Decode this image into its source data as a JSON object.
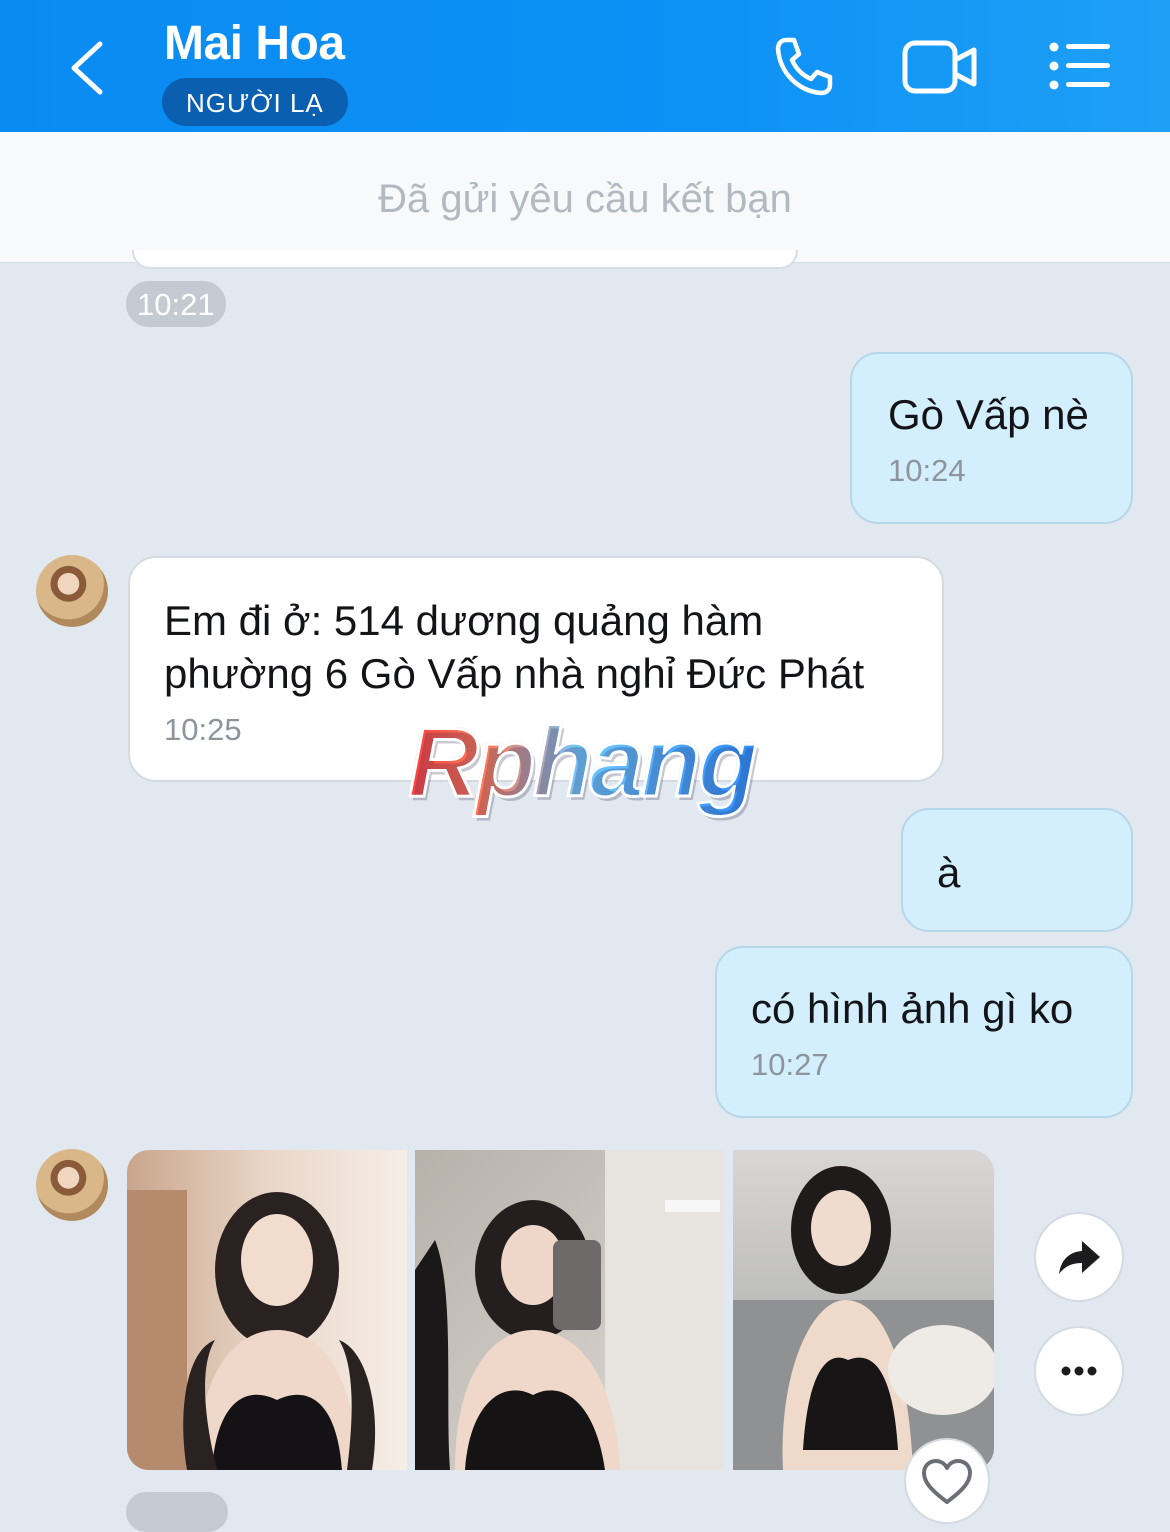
{
  "header": {
    "title": "Mai Hoa",
    "badge": "NGƯỜI LẠ",
    "back_icon": "chevron-left-icon",
    "call_icon": "phone-icon",
    "video_icon": "video-camera-icon",
    "menu_icon": "list-menu-icon",
    "background": "#0d91f5"
  },
  "banner": {
    "text": "Đã gửi yêu cầu kết bạn"
  },
  "messages": [
    {
      "side": "them",
      "time": "10:21"
    },
    {
      "side": "me",
      "text": "Gò Vấp nè",
      "time": "10:24"
    },
    {
      "side": "them",
      "lines": [
        "Em đi ở: 514 dương quảng hàm",
        "phường 6 Gò Vấp nhà nghỉ Đức Phát"
      ],
      "time": "10:25"
    },
    {
      "side": "me",
      "text": "à"
    },
    {
      "side": "me",
      "text": "có hình ảnh gì ko",
      "time": "10:27"
    },
    {
      "side": "them",
      "type": "photos",
      "count": 3
    }
  ],
  "actions": {
    "share_icon": "share-arrow-icon",
    "more_icon": "more-dots-icon",
    "reaction_icon": "heart-icon"
  },
  "watermark": {
    "text": "Rphang"
  },
  "colors": {
    "me_bubble": "#d3eefc",
    "them_bubble": "#ffffff",
    "chat_bg": "#e2e8ef"
  }
}
